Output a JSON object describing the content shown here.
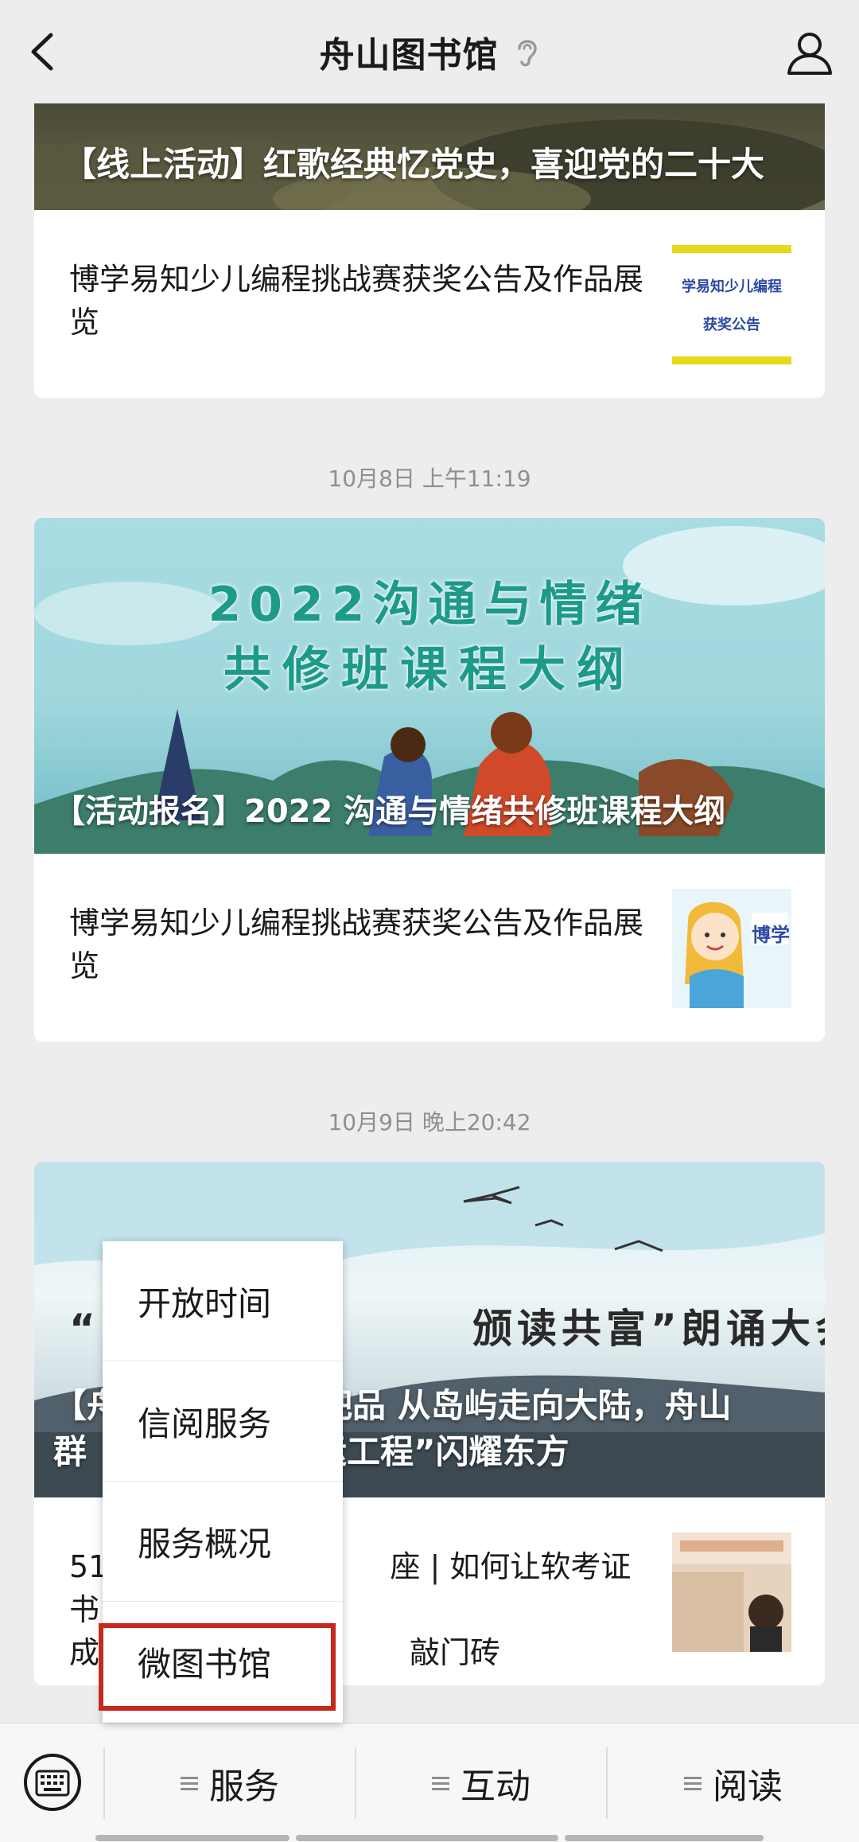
{
  "header": {
    "title": "舟山图书馆"
  },
  "feed": {
    "card1": {
      "cover_title": "【线上活动】红歌经典忆党史，喜迎党的二十大",
      "sub_text": "博学易知少儿编程挑战赛获奖公告及作品展览",
      "thumb_line1": "学易知少儿编程",
      "thumb_line2": "获奖公告"
    },
    "timestamp2": "10月8日 上午11:19",
    "card2": {
      "banner_line1": "2022沟通与情绪",
      "banner_line2": "共修班课程大纲",
      "cover_title": "【活动报名】2022 沟通与情绪共修班课程大纲",
      "sub_text": "博学易知少儿编程挑战赛获奖公告及作品展览",
      "thumb_label": "博学"
    },
    "timestamp3": "10月9日 晚上20:42",
    "card3": {
      "banner_quote": "“                    颁读共富”朗诵大会",
      "cover_title_a": "【舟",
      "cover_title_b": "吧品 从岛屿走向大陆，舟山",
      "cover_title_c": "群",
      "cover_title_d": "运工程”闪耀东方",
      "sub_a": "51",
      "sub_b": "座 | 如何让软考证书",
      "sub_c": "成",
      "sub_d": "敲门砖"
    }
  },
  "popup_menu": {
    "items": [
      "开放时间",
      "信阅服务",
      "服务概况",
      "微图书馆"
    ],
    "highlighted": "微图书馆"
  },
  "bottom_menu": {
    "tabs": [
      "服务",
      "互动",
      "阅读"
    ]
  },
  "colors": {
    "highlight_border": "#c4291d",
    "background": "#ededed"
  }
}
